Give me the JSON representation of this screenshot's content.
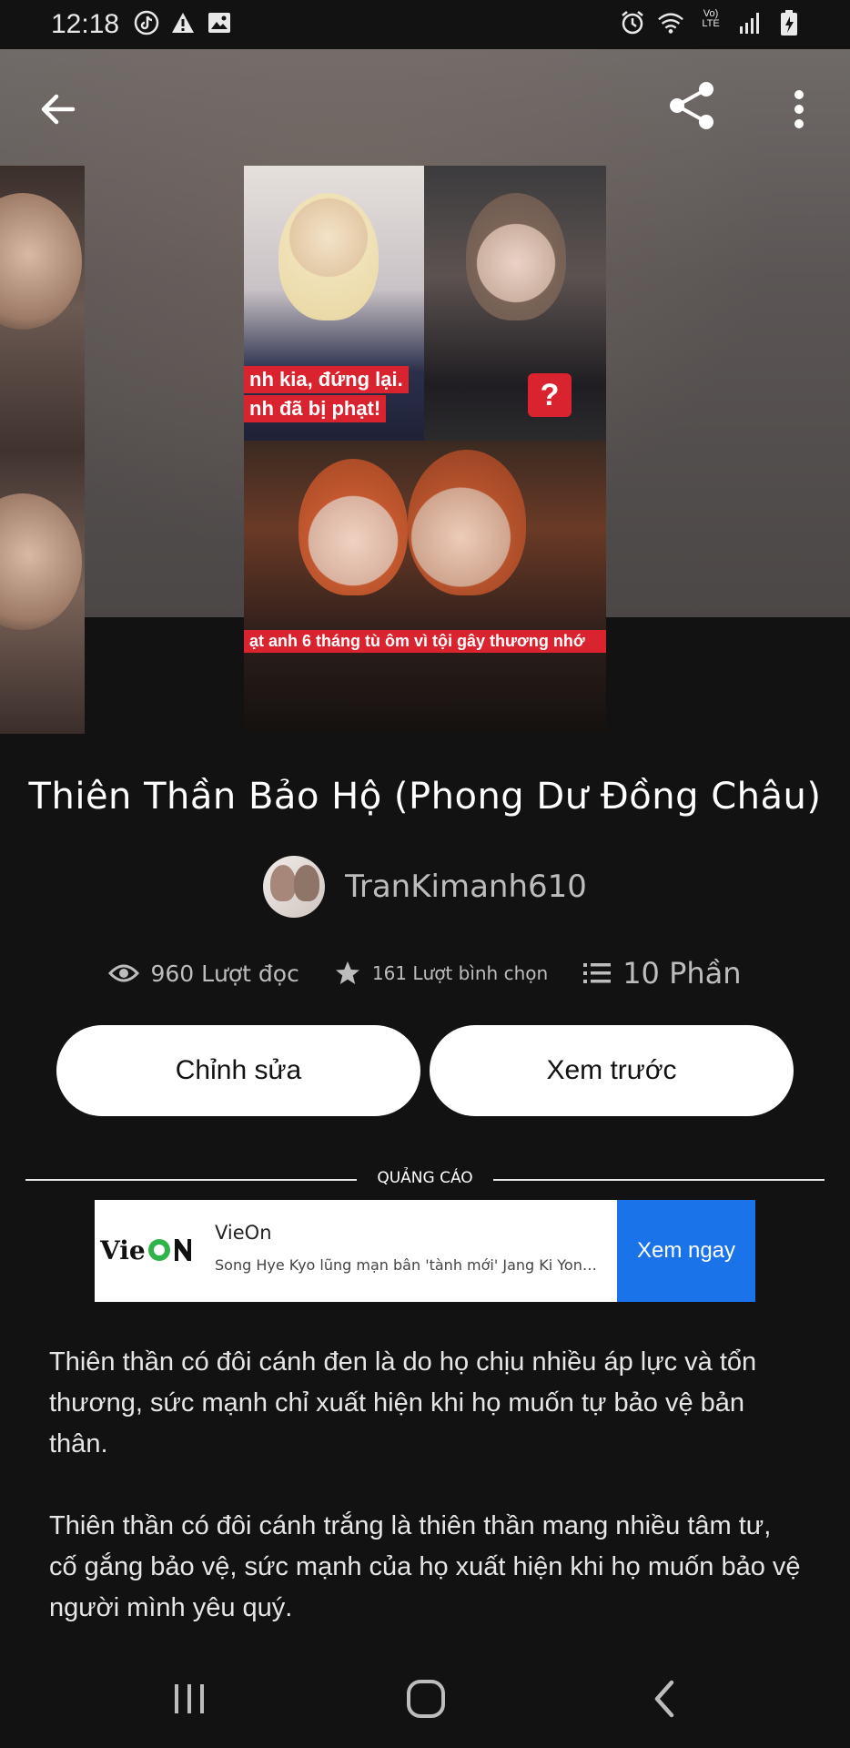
{
  "status_bar": {
    "time": "12:18",
    "left_icons": [
      "tiktok-icon",
      "warning-icon",
      "image-icon"
    ],
    "right_icons": [
      "alarm-icon",
      "wifi-icon",
      "volte-icon",
      "signal-icon",
      "battery-icon"
    ],
    "network_label": "Vo) LTE"
  },
  "cover": {
    "caption_1": "nh kia, đứng lại.",
    "caption_2": "nh đã bị phạt!",
    "caption_3": "ạt anh 6 tháng tù ôm vì tội gây thương nhớ",
    "badge": "?"
  },
  "story": {
    "title": "Thiên Thần Bảo Hộ (Phong Dư Đồng Châu)",
    "author": "TranKimanh610",
    "reads": "960 Lượt đọc",
    "votes": "161 Lượt bình chọn",
    "parts": "10 Phần"
  },
  "actions": {
    "edit_label": "Chỉnh sửa",
    "preview_label": "Xem trước"
  },
  "ad": {
    "label": "QUẢNG CÁO",
    "logo_text": "Vie ON",
    "brand": "VieOn",
    "description": "Song Hye Kyo lũng mạn bân 'tành mới' Jang Ki Yong t...",
    "cta": "Xem ngay"
  },
  "description": {
    "paragraph_1": "Thiên thần có đôi cánh đen là do họ chịu nhiều áp lực và tổn thương, sức mạnh chỉ xuất hiện khi họ muốn tự bảo vệ bản thân.",
    "paragraph_2": "Thiên thần có đôi cánh trắng là thiên thần mang nhiều tâm tư, cố gắng bảo vệ, sức mạnh của họ xuất hiện khi họ muốn bảo vệ người mình yêu quý."
  },
  "colors": {
    "background": "#121212",
    "ad_cta": "#1a73e8",
    "caption_red": "#d9232e"
  }
}
